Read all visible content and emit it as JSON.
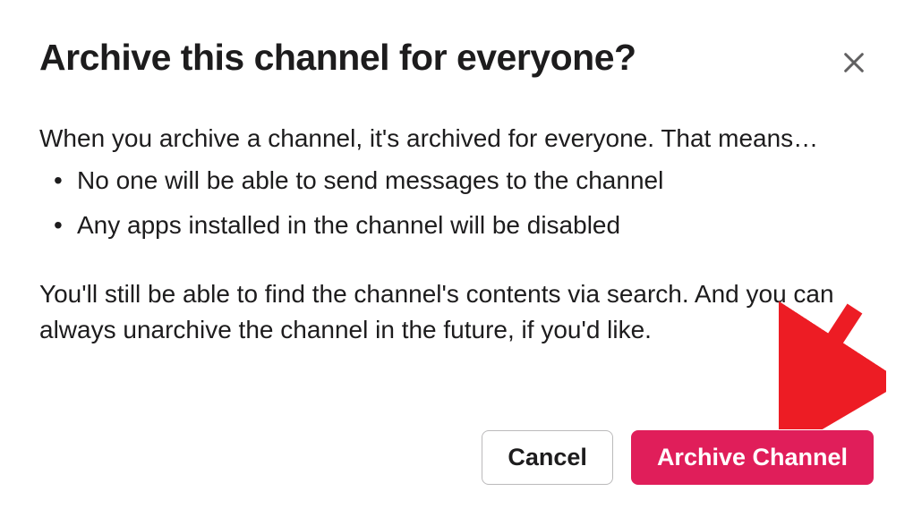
{
  "dialog": {
    "title": "Archive this channel for everyone?",
    "intro": "When you archive a channel, it's archived for everyone. That means…",
    "bullets": [
      "No one will be able to send messages to the channel",
      "Any apps installed in the channel will be disabled"
    ],
    "footer_text": "You'll still be able to find the channel's contents via search. And you can always unarchive the channel in the future, if you'd like.",
    "cancel_label": "Cancel",
    "confirm_label": "Archive Channel"
  },
  "colors": {
    "danger": "#e01e5a",
    "annotation": "#ed1c24"
  }
}
